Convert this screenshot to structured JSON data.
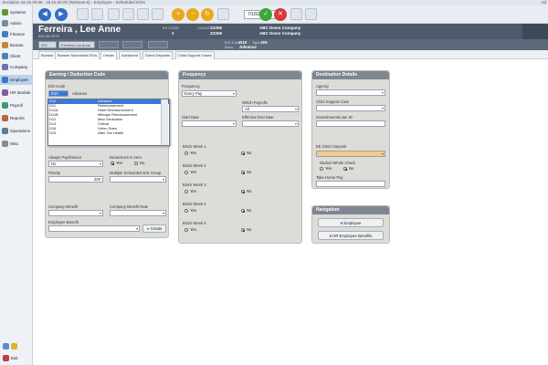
{
  "window": {
    "title": "Evolution 18.15.00.06 : 18.15.00.00 (Release.6) - Employee - Scheduled E/Ds",
    "right_text": "Ad"
  },
  "toolbar": {
    "date": "7/16/2018"
  },
  "sidebar": {
    "items": [
      {
        "label": "Systems",
        "color": "#5a9a3c"
      },
      {
        "label": "Admin",
        "color": "#7a8aa0"
      },
      {
        "label": "Finance",
        "color": "#3f7fc0"
      },
      {
        "label": "Bureau",
        "color": "#c08a2a"
      },
      {
        "label": "Client",
        "color": "#4a80b8"
      },
      {
        "label": "Company",
        "color": "#6f6fb0"
      },
      {
        "label": "Employee",
        "color": "#3a78c8"
      },
      {
        "label": "HR Module",
        "color": "#8a5aa0"
      },
      {
        "label": "Payroll",
        "color": "#3f9a6a"
      },
      {
        "label": "Reports",
        "color": "#b06a3a"
      },
      {
        "label": "Operations",
        "color": "#5a7a9a"
      },
      {
        "label": "Misc",
        "color": "#8a8a8a"
      }
    ],
    "exit_label": "Exit"
  },
  "header": {
    "name": "Ferreira , Lee Anne",
    "ssn": "025-46-7673",
    "ee_code_label": "EE CODE",
    "ee_code": "2",
    "client_label": "CLIENT",
    "client_code": "ZZ206",
    "company_code": "ZZ206",
    "client_name": "ABC Demo Company",
    "company_name": "ABC Demo Company",
    "ed_code_label": "E/D Code:",
    "ed_code": "D10",
    "type_label": "Type:",
    "type": "DN",
    "desc_label": "Desc:",
    "desc": "Advance"
  },
  "subbar": {
    "ee_select": "202",
    "name_select": "Ferreira Lee Anne"
  },
  "tabs": [
    "Browse",
    "Browse Scheduled E/Ds",
    "Details",
    "Advanced",
    "Direct Deposits",
    "Child Support Cases"
  ],
  "earning": {
    "title": "Earning / Deduction Code",
    "ed_code_label": "E/D Code",
    "ed_code_value": "D10",
    "ed_desc": "Advance",
    "always_pay_label": "Always Pay/Deduct",
    "always_pay_value": "No",
    "deductions_zero_label": "Deductions to zero",
    "yes": "Yes",
    "no": "No",
    "priority_label": "Priority",
    "priority_value": "200",
    "multiple_label": "Multiple Scheduled E/D Group",
    "company_benefit_label": "Company Benefit",
    "company_benefit_rate_label": "Company Benefit Rate",
    "employee_benefit_label": "Employee Benefit",
    "create_label": "Create"
  },
  "dropdown": {
    "rows": [
      {
        "code": "D10",
        "desc": "Advance"
      },
      {
        "code": "D11",
        "desc": "Reimbursement"
      },
      {
        "code": "D11A",
        "desc": "Hotel Reimbursement"
      },
      {
        "code": "D11B",
        "desc": "Mileage Reimbursement"
      },
      {
        "code": "D12",
        "desc": "Misc Deduction"
      },
      {
        "code": "D13",
        "desc": "Critical"
      },
      {
        "code": "D18",
        "desc": "Union Dues"
      },
      {
        "code": "D19",
        "desc": "After Tax Health"
      }
    ]
  },
  "frequency": {
    "title": "Frequency",
    "frequency_label": "Frequency",
    "frequency_value": "Every Pay",
    "which_payrolls_label": "Which Payrolls",
    "which_payrolls_value": "All",
    "start_date_label": "Start Date",
    "effective_end_label": "Effective End Date",
    "blocks": [
      "Block Week 1",
      "Block Week 2",
      "Block Week 3",
      "Block Week 4",
      "Block Week 5"
    ],
    "yes": "Yes",
    "no": "No"
  },
  "destination": {
    "title": "Destination Details",
    "agency_label": "Agency",
    "child_support_label": "Child Support Case",
    "garnishment_label": "Garnishment/Loan ID",
    "ee_dd_label": "EE Direct Deposit",
    "deduct_whole_label": "Deduct Whole Check",
    "yes": "Yes",
    "no": "No",
    "take_home_label": "Take Home Pay"
  },
  "navigation": {
    "title": "Navigation",
    "employee_btn": "Employee",
    "hr_btn": "HR Employee Benefits"
  }
}
